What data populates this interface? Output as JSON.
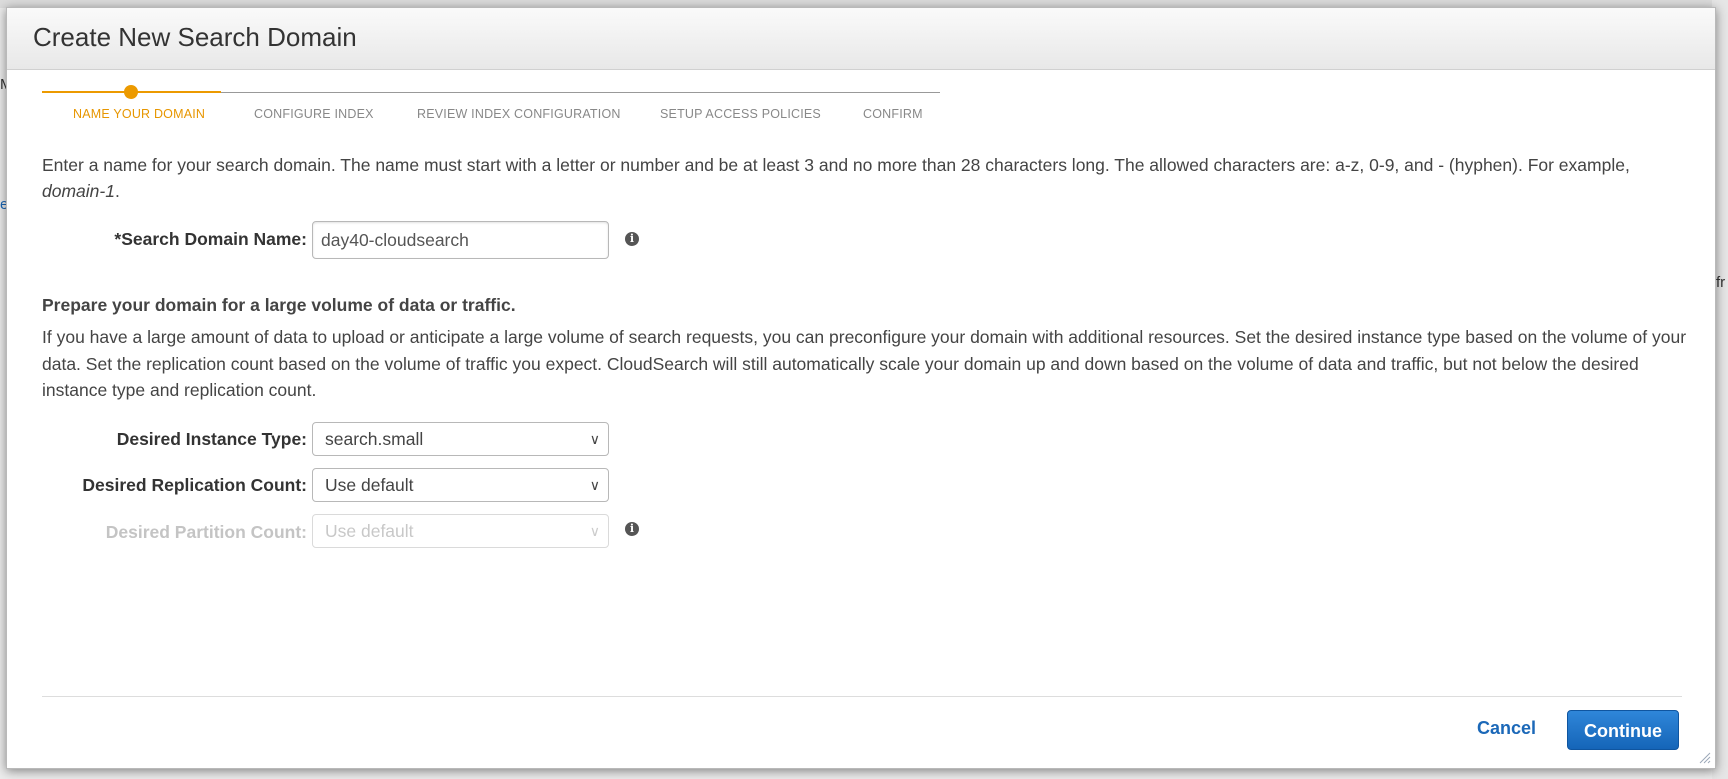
{
  "modal": {
    "title": "Create New Search Domain"
  },
  "wizard": {
    "steps": [
      {
        "label": "NAME YOUR DOMAIN",
        "active": true
      },
      {
        "label": "CONFIGURE INDEX",
        "active": false
      },
      {
        "label": "REVIEW INDEX CONFIGURATION",
        "active": false
      },
      {
        "label": "SETUP ACCESS POLICIES",
        "active": false
      },
      {
        "label": "CONFIRM",
        "active": false
      }
    ],
    "active_color": "#ec9a00"
  },
  "intro": {
    "text": "Enter a name for your search domain. The name must start with a letter or number and be at least 3 and no more than 28 characters long. The allowed characters are: a-z, 0-9, and - (hyphen). For example, ",
    "example": "domain-1",
    "suffix": "."
  },
  "domain_name": {
    "label": "*Search Domain Name:",
    "value": "day40-cloudsearch",
    "info_icon": "info-icon"
  },
  "capacity": {
    "heading": "Prepare your domain for a large volume of data or traffic.",
    "body": "If you have a large amount of data to upload or anticipate a large volume of search requests, you can preconfigure your domain with additional resources. Set the desired instance type based on the volume of your data. Set the replication count based on the volume of traffic you expect. CloudSearch will still automatically scale your domain up and down based on the volume of data and traffic, but not below the desired instance type and replication count."
  },
  "instance_type": {
    "label": "Desired Instance Type:",
    "value": "search.small"
  },
  "replication_count": {
    "label": "Desired Replication Count:",
    "value": "Use default"
  },
  "partition_count": {
    "label": "Desired Partition Count:",
    "value": "Use default",
    "disabled": true
  },
  "footer": {
    "cancel_label": "Cancel",
    "continue_label": "Continue"
  },
  "background_fragments": {
    "left_a": "M",
    "left_b": "e",
    "right": "fr"
  },
  "colors": {
    "accent": "#ec9a00",
    "primary_button": "#1e74c8",
    "link": "#1b68b8"
  }
}
